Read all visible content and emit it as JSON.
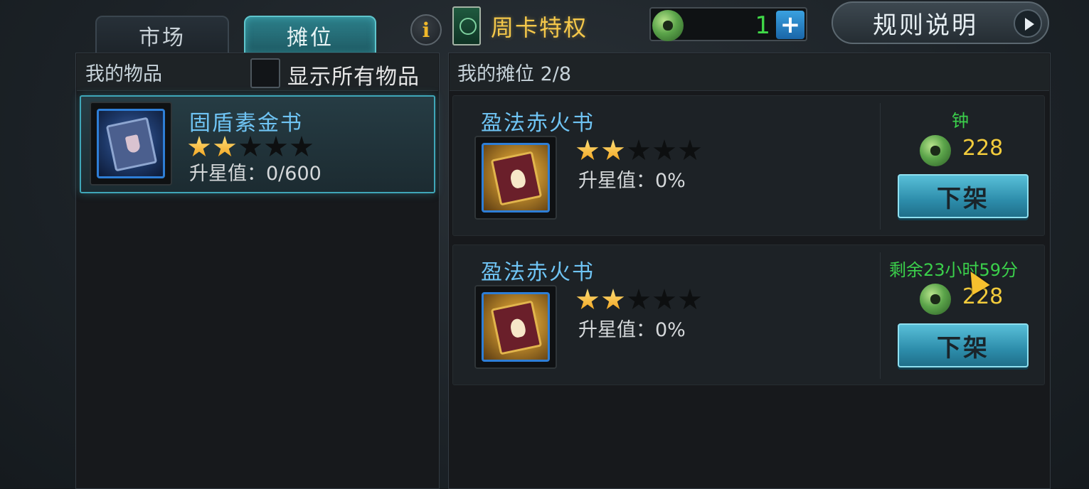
{
  "tabs": {
    "market": "市场",
    "stall": "摊位"
  },
  "header": {
    "info_icon": "info-icon",
    "weekly_card": "周卡特权",
    "currency_icon": "jade-coin-icon",
    "currency_amount": "1",
    "plus_label": "+",
    "rules_button": "规则说明"
  },
  "left_panel": {
    "title": "我的物品",
    "show_all_label": "显示所有物品",
    "show_all_checked": false,
    "items": [
      {
        "name": "固盾素金书",
        "stars_filled": 2,
        "stars_total": 5,
        "upstar_label": "升星值：0/600"
      }
    ]
  },
  "right_panel": {
    "title": "我的摊位 2/8",
    "listings": [
      {
        "name": "盈法赤火书",
        "stars_filled": 2,
        "stars_total": 5,
        "upstar_label": "升星值：0%",
        "status": "钟",
        "price": "228",
        "button": "下架"
      },
      {
        "name": "盈法赤火书",
        "stars_filled": 2,
        "stars_total": 5,
        "upstar_label": "升星值：0%",
        "status": "剩余23小时59分",
        "price": "228",
        "button": "下架"
      }
    ]
  },
  "colors": {
    "accent_teal": "#3fa6b8",
    "item_name_blue": "#6fc4f4",
    "price_gold": "#f3cc3c",
    "status_green": "#3bd04b",
    "weekly_gold": "#f5c84a"
  }
}
